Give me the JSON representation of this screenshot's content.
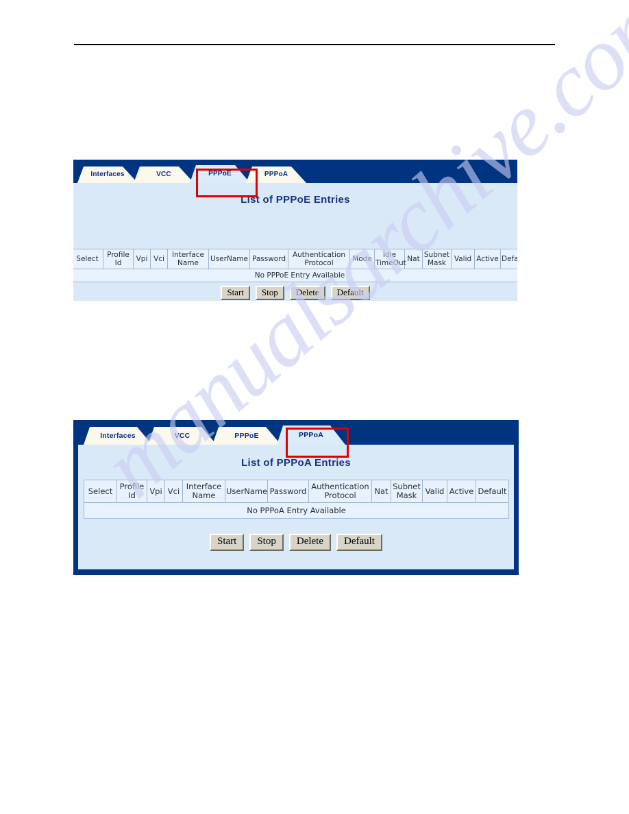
{
  "page": {
    "top_rule": true,
    "watermark_text": "manualsarchive.com"
  },
  "panels": [
    {
      "id": "pppoe",
      "tabs": [
        {
          "label": "Interfaces",
          "active": false
        },
        {
          "label": "VCC",
          "active": false
        },
        {
          "label": "PPPoE",
          "active": true
        },
        {
          "label": "PPPoA",
          "active": false
        }
      ],
      "title": "List of PPPoE Entries",
      "table": {
        "headers": [
          "Select",
          "Profile Id",
          "Vpi",
          "Vci",
          "Interface Name",
          "UserName",
          "Password",
          "Authentication Protocol",
          "Mode",
          "Idle TimeOut",
          "Nat",
          "Subnet Mask",
          "Valid",
          "Active",
          "Default"
        ],
        "empty_message": "No PPPoE Entry Available",
        "rows": []
      },
      "buttons": [
        {
          "label": "Start"
        },
        {
          "label": "Stop"
        },
        {
          "label": "Delete"
        },
        {
          "label": "Default"
        }
      ],
      "highlight": "PPPoE"
    },
    {
      "id": "pppoa",
      "tabs": [
        {
          "label": "Interfaces",
          "active": false
        },
        {
          "label": "VCC",
          "active": false
        },
        {
          "label": "PPPoE",
          "active": false
        },
        {
          "label": "PPPoA",
          "active": true
        }
      ],
      "title": "List of PPPoA Entries",
      "table": {
        "headers": [
          "Select",
          "Profile Id",
          "Vpi",
          "Vci",
          "Interface Name",
          "UserName",
          "Password",
          "Authentication Protocol",
          "Nat",
          "Subnet Mask",
          "Valid",
          "Active",
          "Default"
        ],
        "empty_message": "No PPPoA Entry Available",
        "rows": []
      },
      "buttons": [
        {
          "label": "Start"
        },
        {
          "label": "Stop"
        },
        {
          "label": "Delete"
        },
        {
          "label": "Default"
        }
      ],
      "highlight": "PPPoA"
    }
  ],
  "colors": {
    "banner_navy": "#003380",
    "panel_blue": "#dae9f8",
    "table_blue": "#e8f2fc",
    "title_navy": "#16357e",
    "highlight_red": "#e00000",
    "tab_inactive": "#fbf8ee",
    "tab_active": "#dcecfb",
    "button_face": "#d8d4c8"
  }
}
